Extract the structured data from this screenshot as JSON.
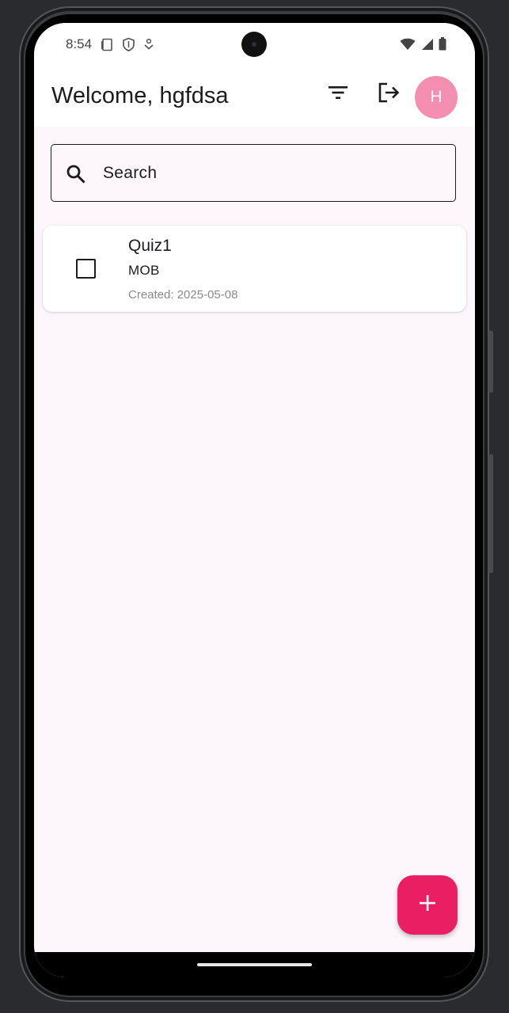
{
  "status_bar": {
    "time": "8:54",
    "left_icons": [
      "sim-card-icon",
      "shield-icon",
      "download-icon"
    ],
    "right_icons": [
      "wifi-icon",
      "signal-icon",
      "battery-icon"
    ]
  },
  "app_bar": {
    "title": "Welcome, hgfdsa",
    "filter_icon": "filter-icon",
    "logout_icon": "logout-icon",
    "avatar_initial": "H",
    "avatar_color": "#f48fb1"
  },
  "search": {
    "placeholder": "Search",
    "icon": "search-icon"
  },
  "quizzes": [
    {
      "title": "Quiz1",
      "subject": "MOB",
      "created": "Created: 2025-05-08",
      "checked": false
    }
  ],
  "fab": {
    "icon": "plus-icon",
    "color": "#e91e63"
  },
  "colors": {
    "background": "#fdf7fc",
    "accent": "#e91e63"
  }
}
